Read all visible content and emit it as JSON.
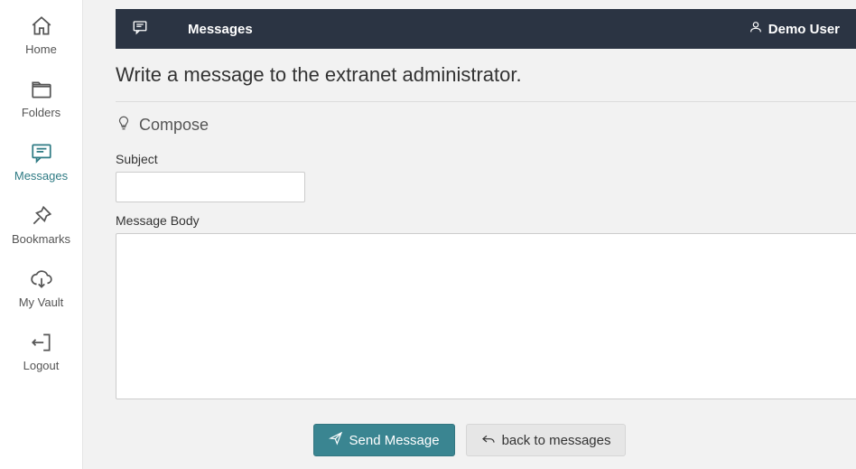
{
  "sidebar": {
    "items": [
      {
        "label": "Home"
      },
      {
        "label": "Folders"
      },
      {
        "label": "Messages"
      },
      {
        "label": "Bookmarks"
      },
      {
        "label": "My Vault"
      },
      {
        "label": "Logout"
      }
    ]
  },
  "topbar": {
    "title": "Messages",
    "user_name": "Demo User"
  },
  "page": {
    "heading": "Write a message to the extranet administrator.",
    "compose_title": "Compose",
    "subject_label": "Subject",
    "subject_value": "",
    "body_label": "Message Body",
    "body_value": ""
  },
  "buttons": {
    "send": "Send Message",
    "back": "back to messages"
  },
  "colors": {
    "topbar_bg": "#2b3443",
    "primary": "#3a8591",
    "active_nav": "#2f7b84"
  }
}
